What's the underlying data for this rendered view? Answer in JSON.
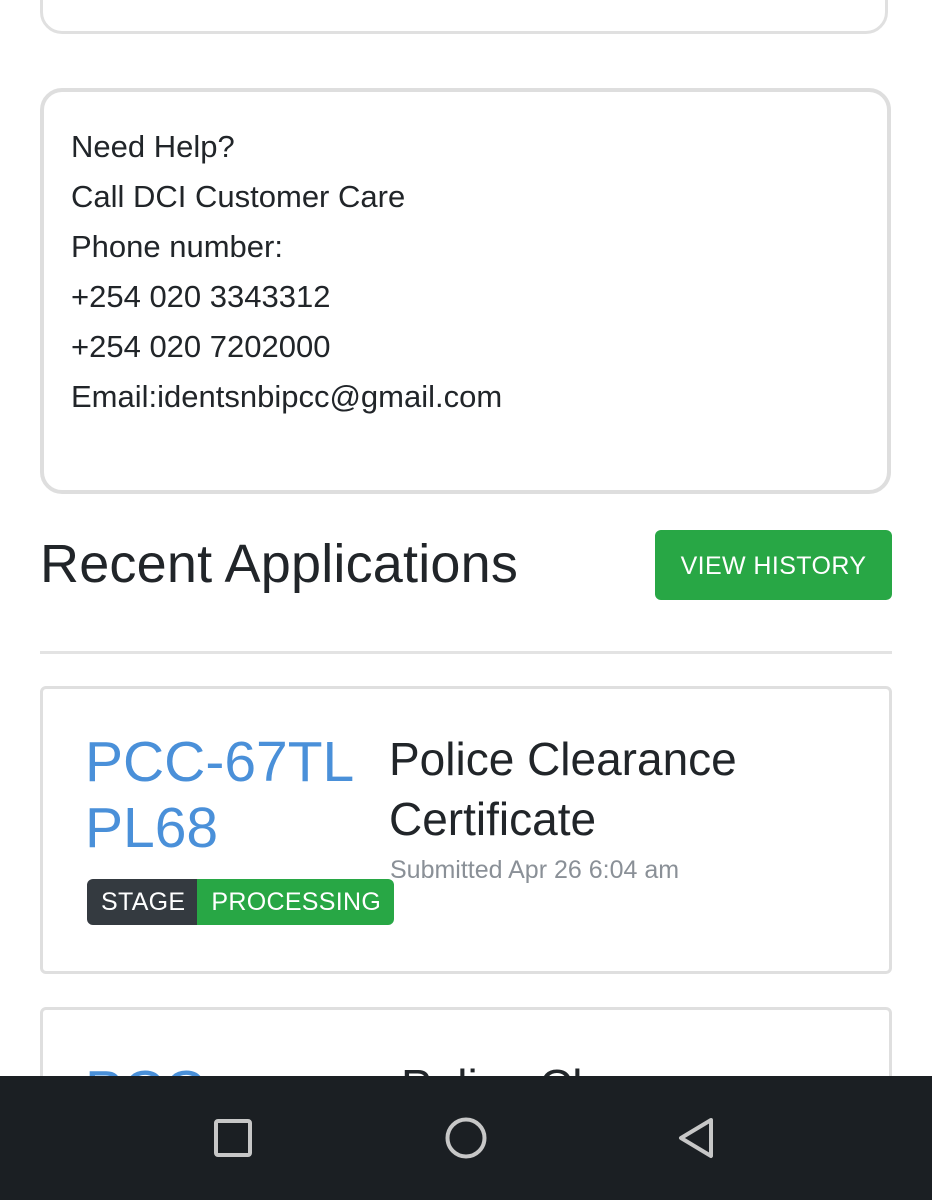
{
  "help": {
    "lines": [
      "Need Help?",
      "Call DCI Customer Care",
      "Phone number:",
      "+254 020 3343312",
      "+254 020 7202000",
      "Email:identsnbipcc@gmail.com"
    ]
  },
  "recent": {
    "title": "Recent Applications",
    "view_history_label": "VIEW HISTORY"
  },
  "applications": [
    {
      "id": "PCC-67TLPL68",
      "title": "Police Clearance Certificate",
      "submitted": "Submitted Apr 26 6:04 am",
      "stage_label": "STAGE",
      "stage_value": "PROCESSING"
    },
    {
      "id": "PCC-",
      "title": "Police Clearance"
    }
  ],
  "colors": {
    "accent_green": "#28a745",
    "id_blue": "#4a90d9",
    "badge_dark": "#343a40",
    "navbar": "#1b1f23"
  },
  "navbar": {
    "icons": [
      "recent-apps-icon",
      "home-icon",
      "back-icon"
    ]
  }
}
